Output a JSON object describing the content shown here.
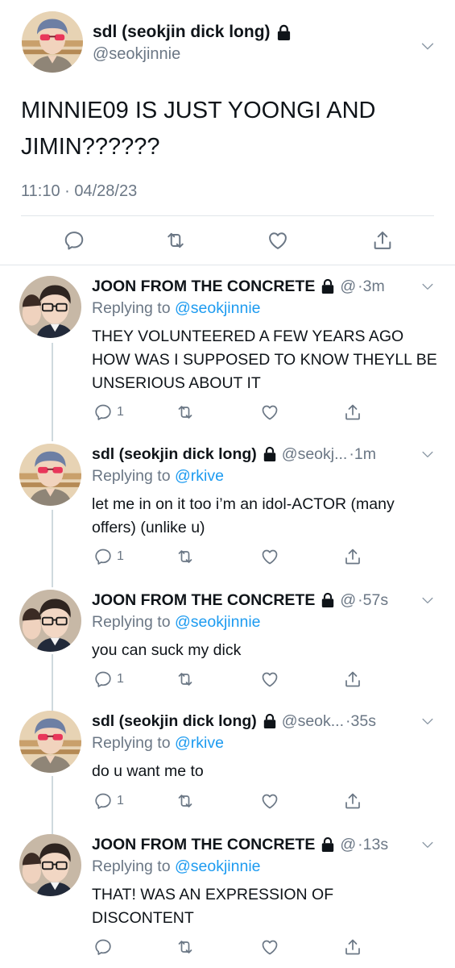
{
  "main_tweet": {
    "display_name": "sdl (seokjin dick long)",
    "handle": "@seokjinnie",
    "text": "MINNIE09 IS JUST YOONGI AND JIMIN??????",
    "timestamp": "11:10 · 04/28/23",
    "avatar": "avatar-seokjin"
  },
  "replies": [
    {
      "display_name": "JOON FROM THE CONCRETE",
      "handle": "@",
      "time": "·3m",
      "replying_prefix": "Replying to ",
      "replying_to": "@seokjinnie",
      "text": "THEY VOLUNTEERED A FEW YEARS AGO HOW WAS I SUPPOSED TO KNOW THEYLL BE UNSERIOUS ABOUT IT",
      "reply_count": "1",
      "avatar": "avatar-joon"
    },
    {
      "display_name": "sdl (seokjin dick long)",
      "handle": "@seokj...",
      "time": "·1m",
      "replying_prefix": "Replying to ",
      "replying_to": "@rkive",
      "text": "let me in on it too i’m an idol-ACTOR (many offers) (unlike u)",
      "reply_count": "1",
      "avatar": "avatar-seokjin"
    },
    {
      "display_name": "JOON FROM THE CONCRETE",
      "handle": "@",
      "time": "·57s",
      "replying_prefix": "Replying to ",
      "replying_to": "@seokjinnie",
      "text": "you can suck my dick",
      "reply_count": "1",
      "avatar": "avatar-joon"
    },
    {
      "display_name": "sdl (seokjin dick long)",
      "handle": "@seok...",
      "time": "·35s",
      "replying_prefix": "Replying to ",
      "replying_to": "@rkive",
      "text": "do u want me to",
      "reply_count": "1",
      "avatar": "avatar-seokjin"
    },
    {
      "display_name": "JOON FROM THE CONCRETE",
      "handle": "@",
      "time": "·13s",
      "replying_prefix": "Replying to ",
      "replying_to": "@seokjinnie",
      "text": "THAT! WAS AN EXPRESSION OF DISCONTENT",
      "reply_count": "",
      "avatar": "avatar-joon"
    }
  ],
  "icons": {
    "reply": "reply-icon",
    "retweet": "retweet-icon",
    "like": "heart-icon",
    "share": "share-icon",
    "lock": "lock-icon",
    "more": "chevron-down-icon"
  },
  "colors": {
    "text": "#0f1419",
    "secondary": "#6b7785",
    "link": "#1d9bf0",
    "divider": "#e1e6ea"
  }
}
